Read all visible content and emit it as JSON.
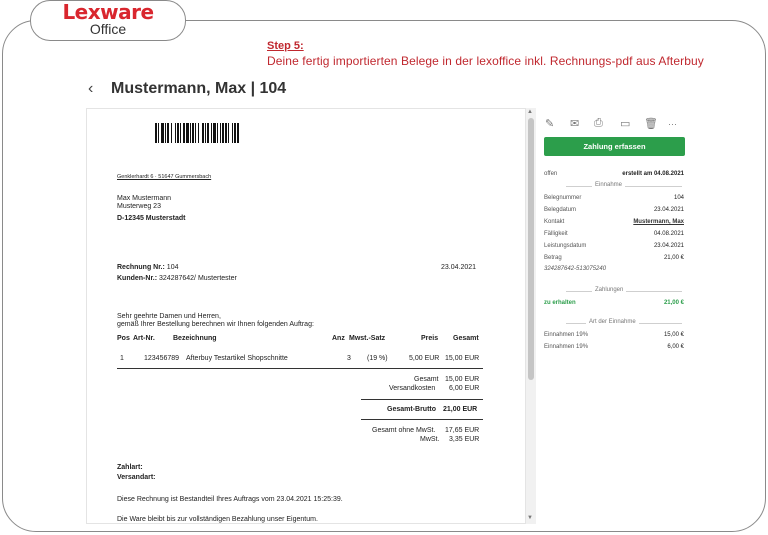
{
  "brand": {
    "logo_top": "Lexware",
    "logo_bottom": "Office"
  },
  "instruction": {
    "step": "Step 5:",
    "text": "Deine fertig importierten Belege in der lexoffice inkl. Rechnungs-pdf aus Afterbuy"
  },
  "header": {
    "back_icon": "chevron-left-icon",
    "back_glyph": "‹",
    "title": "Mustermann, Max | 104"
  },
  "invoice": {
    "sender_line": "Genklerhardt 6 · 51647 Gummersbach",
    "recipient_name": "Max Mustermann",
    "recipient_street": "Musterweg 23",
    "recipient_city": "D-12345 Musterstadt",
    "invoice_no_label": "Rechnung Nr.:",
    "invoice_no": "104",
    "date": "23.04.2021",
    "customer_no_label": "Kunden-Nr.:",
    "customer_no": "324287642/ Mustertester",
    "greeting": "Sehr geehrte Damen und Herren,",
    "intro": "gemäß Ihrer Bestellung berechnen wir Ihnen folgenden Auftrag:",
    "columns": {
      "pos": "Pos",
      "art": "Art-Nr.",
      "desc": "Bezeichnung",
      "qty": "Anz",
      "vat": "Mwst.-Satz",
      "price": "Preis",
      "total": "Gesamt"
    },
    "items": [
      {
        "pos": "1",
        "art": "123456789",
        "desc": "Afterbuy Testartikel Shopschnitte",
        "qty": "3",
        "vat": "(19 %)",
        "price": "5,00 EUR",
        "total": "15,00 EUR"
      }
    ],
    "sum_label": "Gesamt",
    "sum_value": "15,00 EUR",
    "shipping_label": "Versandkosten",
    "shipping_value": "6,00 EUR",
    "gross_label": "Gesamt-Brutto",
    "gross_value": "21,00 EUR",
    "net_label": "Gesamt ohne MwSt.",
    "net_value": "17,65 EUR",
    "vat_label": "MwSt.",
    "vat_value": "3,35 EUR",
    "payment_label": "Zahlart:",
    "shipping_method_label": "Versandart:",
    "footer1": "Diese Rechnung ist Bestandteil Ihres Auftrags vom 23.04.2021 15:25:39.",
    "footer2": "Die Ware bleibt bis zur vollständigen Bezahlung unser Eigentum."
  },
  "scroll": {
    "up": "▲",
    "down": "▼"
  },
  "toolbar": {
    "edit": {
      "icon": "pencil-icon",
      "glyph": "✎"
    },
    "mail": {
      "icon": "mail-icon",
      "glyph": "✉"
    },
    "print": {
      "icon": "printer-icon",
      "glyph": "⎙"
    },
    "archive": {
      "icon": "archive-icon",
      "glyph": "▭"
    },
    "delete": {
      "icon": "trash-icon",
      "glyph": "🗑"
    },
    "more": {
      "icon": "more-icon",
      "glyph": "···"
    }
  },
  "sidebar": {
    "pay_button": "Zahlung erfassen",
    "status": "offen",
    "created": "erstellt am 04.08.2021",
    "section_income": "Einnahme",
    "fields": [
      {
        "label": "Belegnummer",
        "value": "104"
      },
      {
        "label": "Belegdatum",
        "value": "23.04.2021"
      },
      {
        "label": "Kontakt",
        "value": "Mustermann, Max"
      },
      {
        "label": "Fälligkeit",
        "value": "04.08.2021"
      },
      {
        "label": "Leistungsdatum",
        "value": "23.04.2021"
      },
      {
        "label": "Betrag",
        "value": "21,00 €"
      }
    ],
    "reference": "324287642-513075240",
    "section_payments": "Zahlungen",
    "to_receive_label": "zu erhalten",
    "to_receive_value": "21,00 €",
    "section_type": "Art der Einnahme",
    "types": [
      {
        "label": "Einnahmen 19%",
        "value": "15,00 €"
      },
      {
        "label": "Einnahmen 19%",
        "value": "6,00 €"
      }
    ]
  },
  "colors": {
    "accent": "#c0282f",
    "brand_red": "#d9262e",
    "button_green": "#2c9e4b"
  }
}
